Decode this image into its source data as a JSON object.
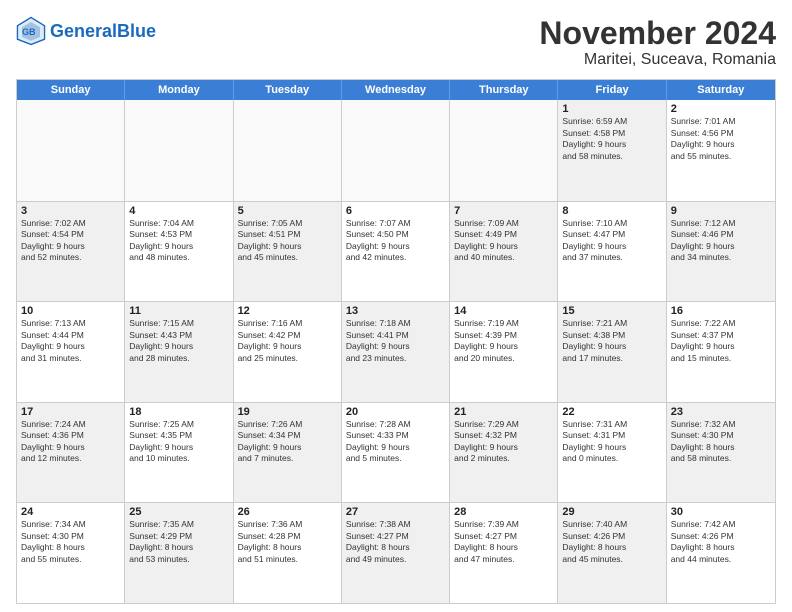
{
  "logo": {
    "general": "General",
    "blue": "Blue"
  },
  "title": "November 2024",
  "subtitle": "Maritei, Suceava, Romania",
  "header_days": [
    "Sunday",
    "Monday",
    "Tuesday",
    "Wednesday",
    "Thursday",
    "Friday",
    "Saturday"
  ],
  "weeks": [
    [
      {
        "day": "",
        "info": "",
        "empty": true
      },
      {
        "day": "",
        "info": "",
        "empty": true
      },
      {
        "day": "",
        "info": "",
        "empty": true
      },
      {
        "day": "",
        "info": "",
        "empty": true
      },
      {
        "day": "",
        "info": "",
        "empty": true
      },
      {
        "day": "1",
        "info": "Sunrise: 6:59 AM\nSunset: 4:58 PM\nDaylight: 9 hours\nand 58 minutes.",
        "empty": false,
        "shaded": true
      },
      {
        "day": "2",
        "info": "Sunrise: 7:01 AM\nSunset: 4:56 PM\nDaylight: 9 hours\nand 55 minutes.",
        "empty": false,
        "shaded": false
      }
    ],
    [
      {
        "day": "3",
        "info": "Sunrise: 7:02 AM\nSunset: 4:54 PM\nDaylight: 9 hours\nand 52 minutes.",
        "empty": false,
        "shaded": true
      },
      {
        "day": "4",
        "info": "Sunrise: 7:04 AM\nSunset: 4:53 PM\nDaylight: 9 hours\nand 48 minutes.",
        "empty": false,
        "shaded": false
      },
      {
        "day": "5",
        "info": "Sunrise: 7:05 AM\nSunset: 4:51 PM\nDaylight: 9 hours\nand 45 minutes.",
        "empty": false,
        "shaded": true
      },
      {
        "day": "6",
        "info": "Sunrise: 7:07 AM\nSunset: 4:50 PM\nDaylight: 9 hours\nand 42 minutes.",
        "empty": false,
        "shaded": false
      },
      {
        "day": "7",
        "info": "Sunrise: 7:09 AM\nSunset: 4:49 PM\nDaylight: 9 hours\nand 40 minutes.",
        "empty": false,
        "shaded": true
      },
      {
        "day": "8",
        "info": "Sunrise: 7:10 AM\nSunset: 4:47 PM\nDaylight: 9 hours\nand 37 minutes.",
        "empty": false,
        "shaded": false
      },
      {
        "day": "9",
        "info": "Sunrise: 7:12 AM\nSunset: 4:46 PM\nDaylight: 9 hours\nand 34 minutes.",
        "empty": false,
        "shaded": true
      }
    ],
    [
      {
        "day": "10",
        "info": "Sunrise: 7:13 AM\nSunset: 4:44 PM\nDaylight: 9 hours\nand 31 minutes.",
        "empty": false,
        "shaded": false
      },
      {
        "day": "11",
        "info": "Sunrise: 7:15 AM\nSunset: 4:43 PM\nDaylight: 9 hours\nand 28 minutes.",
        "empty": false,
        "shaded": true
      },
      {
        "day": "12",
        "info": "Sunrise: 7:16 AM\nSunset: 4:42 PM\nDaylight: 9 hours\nand 25 minutes.",
        "empty": false,
        "shaded": false
      },
      {
        "day": "13",
        "info": "Sunrise: 7:18 AM\nSunset: 4:41 PM\nDaylight: 9 hours\nand 23 minutes.",
        "empty": false,
        "shaded": true
      },
      {
        "day": "14",
        "info": "Sunrise: 7:19 AM\nSunset: 4:39 PM\nDaylight: 9 hours\nand 20 minutes.",
        "empty": false,
        "shaded": false
      },
      {
        "day": "15",
        "info": "Sunrise: 7:21 AM\nSunset: 4:38 PM\nDaylight: 9 hours\nand 17 minutes.",
        "empty": false,
        "shaded": true
      },
      {
        "day": "16",
        "info": "Sunrise: 7:22 AM\nSunset: 4:37 PM\nDaylight: 9 hours\nand 15 minutes.",
        "empty": false,
        "shaded": false
      }
    ],
    [
      {
        "day": "17",
        "info": "Sunrise: 7:24 AM\nSunset: 4:36 PM\nDaylight: 9 hours\nand 12 minutes.",
        "empty": false,
        "shaded": true
      },
      {
        "day": "18",
        "info": "Sunrise: 7:25 AM\nSunset: 4:35 PM\nDaylight: 9 hours\nand 10 minutes.",
        "empty": false,
        "shaded": false
      },
      {
        "day": "19",
        "info": "Sunrise: 7:26 AM\nSunset: 4:34 PM\nDaylight: 9 hours\nand 7 minutes.",
        "empty": false,
        "shaded": true
      },
      {
        "day": "20",
        "info": "Sunrise: 7:28 AM\nSunset: 4:33 PM\nDaylight: 9 hours\nand 5 minutes.",
        "empty": false,
        "shaded": false
      },
      {
        "day": "21",
        "info": "Sunrise: 7:29 AM\nSunset: 4:32 PM\nDaylight: 9 hours\nand 2 minutes.",
        "empty": false,
        "shaded": true
      },
      {
        "day": "22",
        "info": "Sunrise: 7:31 AM\nSunset: 4:31 PM\nDaylight: 9 hours\nand 0 minutes.",
        "empty": false,
        "shaded": false
      },
      {
        "day": "23",
        "info": "Sunrise: 7:32 AM\nSunset: 4:30 PM\nDaylight: 8 hours\nand 58 minutes.",
        "empty": false,
        "shaded": true
      }
    ],
    [
      {
        "day": "24",
        "info": "Sunrise: 7:34 AM\nSunset: 4:30 PM\nDaylight: 8 hours\nand 55 minutes.",
        "empty": false,
        "shaded": false
      },
      {
        "day": "25",
        "info": "Sunrise: 7:35 AM\nSunset: 4:29 PM\nDaylight: 8 hours\nand 53 minutes.",
        "empty": false,
        "shaded": true
      },
      {
        "day": "26",
        "info": "Sunrise: 7:36 AM\nSunset: 4:28 PM\nDaylight: 8 hours\nand 51 minutes.",
        "empty": false,
        "shaded": false
      },
      {
        "day": "27",
        "info": "Sunrise: 7:38 AM\nSunset: 4:27 PM\nDaylight: 8 hours\nand 49 minutes.",
        "empty": false,
        "shaded": true
      },
      {
        "day": "28",
        "info": "Sunrise: 7:39 AM\nSunset: 4:27 PM\nDaylight: 8 hours\nand 47 minutes.",
        "empty": false,
        "shaded": false
      },
      {
        "day": "29",
        "info": "Sunrise: 7:40 AM\nSunset: 4:26 PM\nDaylight: 8 hours\nand 45 minutes.",
        "empty": false,
        "shaded": true
      },
      {
        "day": "30",
        "info": "Sunrise: 7:42 AM\nSunset: 4:26 PM\nDaylight: 8 hours\nand 44 minutes.",
        "empty": false,
        "shaded": false
      }
    ]
  ]
}
